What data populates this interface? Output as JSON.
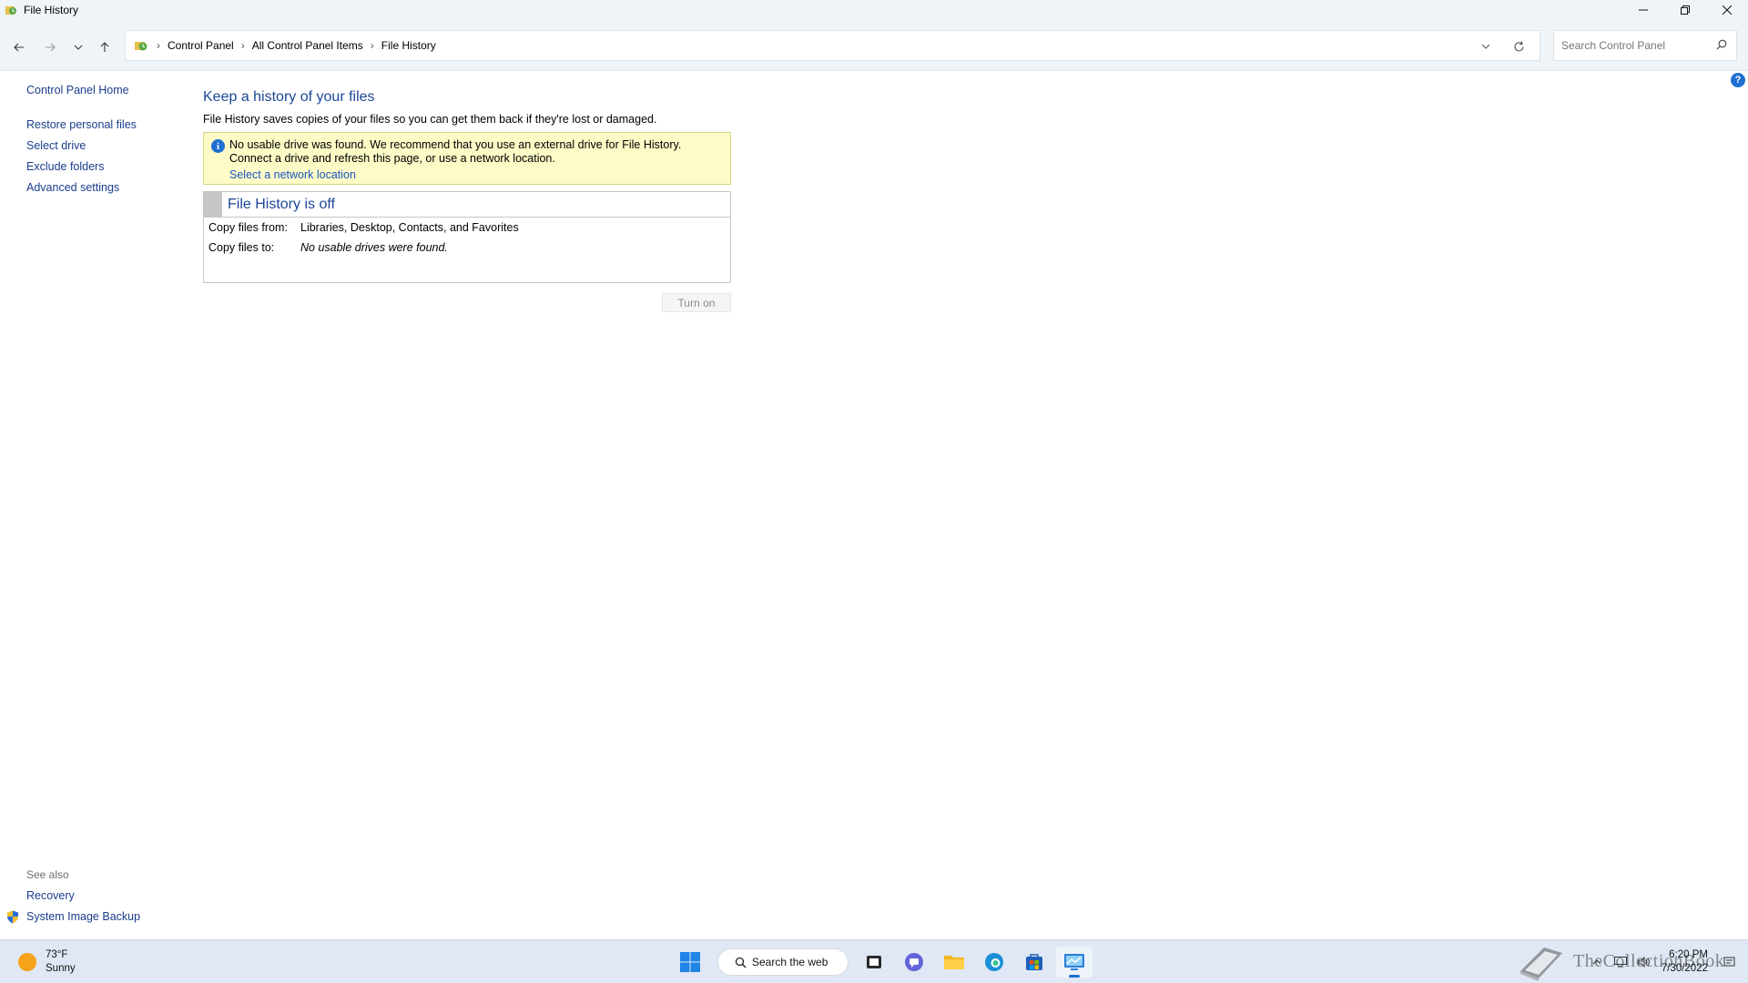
{
  "window": {
    "title": "File History"
  },
  "address": {
    "crumbs": [
      "Control Panel",
      "All Control Panel Items",
      "File History"
    ]
  },
  "search": {
    "placeholder": "Search Control Panel"
  },
  "left_nav": {
    "home": "Control Panel Home",
    "items": [
      "Restore personal files",
      "Select drive",
      "Exclude folders",
      "Advanced settings"
    ]
  },
  "see_also": {
    "header": "See also",
    "items": [
      "Recovery",
      "System Image Backup"
    ]
  },
  "main": {
    "heading": "Keep a history of your files",
    "description": "File History saves copies of your files so you can get them back if they're lost or damaged.",
    "warning": {
      "message": "No usable drive was found. We recommend that you use an external drive for File History. Connect a drive and refresh this page, or use a network location.",
      "link": "Select a network location"
    },
    "status": {
      "title": "File History is off",
      "copy_from_label": "Copy files from:",
      "copy_from_value": "Libraries, Desktop, Contacts, and Favorites",
      "copy_to_label": "Copy files to:",
      "copy_to_value": "No usable drives were found."
    },
    "turn_on_label": "Turn on"
  },
  "taskbar": {
    "weather_temp": "73°F",
    "weather_desc": "Sunny",
    "search_label": "Search the web",
    "time": "6:20 PM",
    "date": "7/30/2022",
    "watermark_text": "TheCollectionBook"
  },
  "colors": {
    "link": "#1a3e8c",
    "heading": "#1d4696",
    "warning_bg": "#fdfcc7",
    "accent": "#1f6fd1"
  }
}
